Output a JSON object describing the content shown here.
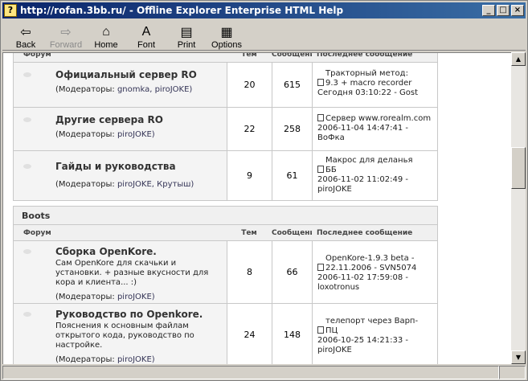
{
  "window": {
    "title": "http://rofan.3bb.ru/ - Offline Explorer Enterprise HTML Help",
    "title_icon": "?"
  },
  "toolbar": {
    "back": "Back",
    "forward": "Forward",
    "home": "Home",
    "font": "Font",
    "print": "Print",
    "options": "Options"
  },
  "table_headers": {
    "forum": "Форум",
    "topics": "Тем",
    "messages": "Сообщени",
    "last": "Последнее сообщение"
  },
  "categories": [
    {
      "name": "",
      "forums": [
        {
          "name": "Официальный сервер RO",
          "desc": "",
          "mods_label": "(Модераторы:",
          "mods": "gnomka, piroJOKE)",
          "topics": "20",
          "posts": "615",
          "last_line1": "Тракторный метод:",
          "last_line2": "9.3 + macro recorder",
          "last_line3": "Сегодня 03:10:22 - Gost"
        },
        {
          "name": "Другие сервера RO",
          "desc": "",
          "mods_label": "(Модераторы:",
          "mods": "piroJOKE)",
          "topics": "22",
          "posts": "258",
          "last_line1": "Сервер www.rorealm.com",
          "last_line2": "2006-11-04 14:47:41 -",
          "last_line3": "ВоФка"
        },
        {
          "name": "Гайды и руководства",
          "desc": "",
          "mods_label": "(Модераторы:",
          "mods": "piroJOKE, Крутыш)",
          "topics": "9",
          "posts": "61",
          "last_line1": "Макрос для деланья",
          "last_line2": "ББ",
          "last_line3": "2006-11-02 11:02:49 -",
          "last_line4": "piroJOKE"
        }
      ]
    },
    {
      "name": "Boots",
      "forums": [
        {
          "name": "Сборка OpenKore.",
          "desc": "Сам OpenKore для скачьки и установки. + разные вкусности для кора и клиента... :)",
          "mods_label": "(Модераторы:",
          "mods": "piroJOKE)",
          "topics": "8",
          "posts": "66",
          "last_line1": "OpenKore-1.9.3 beta -",
          "last_line2": "22.11.2006 - SVN5074",
          "last_line3": "2006-11-02 17:59:08 -",
          "last_line4": "loxotronus"
        },
        {
          "name": "Руководство по Openkore.",
          "desc": "Пояснения к основным файлам открытого кода, руководство по настройке.",
          "mods_label": "(Модераторы:",
          "mods": "piroJOKE)",
          "topics": "24",
          "posts": "148",
          "last_line1": "телепорт через Варп-",
          "last_line2": "ПЦ",
          "last_line3": "2006-10-25 14:21:33 -",
          "last_line4": "piroJOKE"
        }
      ]
    }
  ]
}
